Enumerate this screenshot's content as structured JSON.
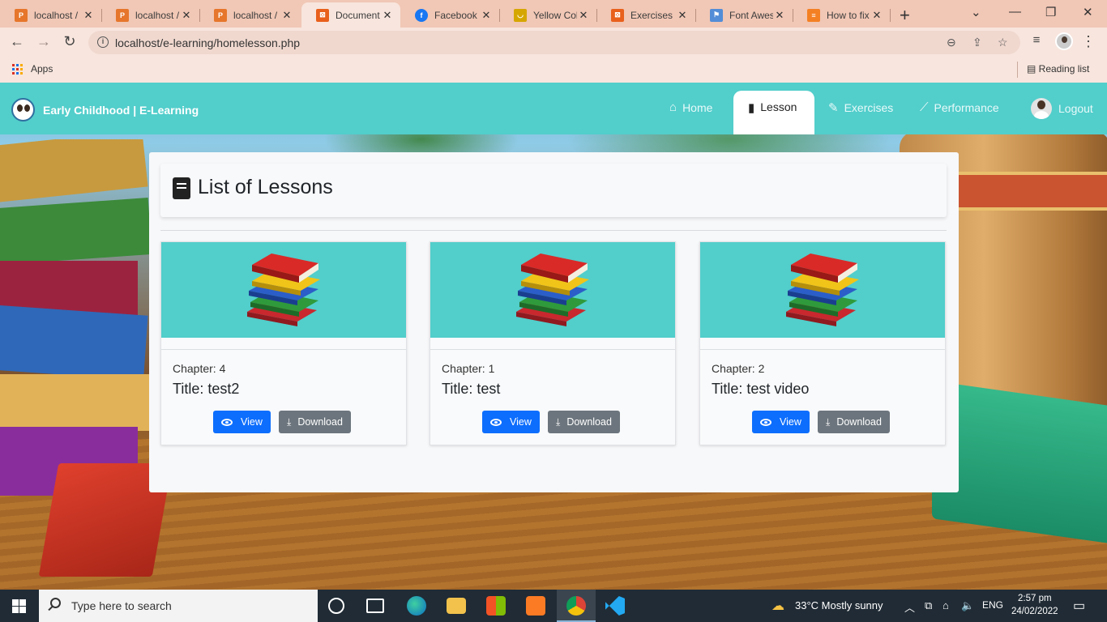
{
  "browser": {
    "tabs": [
      {
        "label": "localhost /",
        "favicon": "pma-icon",
        "color": "#e6762b"
      },
      {
        "label": "localhost /",
        "favicon": "pma-icon",
        "color": "#e6762b"
      },
      {
        "label": "localhost /",
        "favicon": "pma-icon",
        "color": "#e6762b"
      },
      {
        "label": "Document",
        "favicon": "xampp-icon",
        "color": "#e8601c"
      },
      {
        "label": "Facebook",
        "favicon": "facebook-icon",
        "color": "#1877f2"
      },
      {
        "label": "Yellow Col",
        "favicon": "cup-icon",
        "color": "#d6a600"
      },
      {
        "label": "Exercises",
        "favicon": "xampp-icon",
        "color": "#e8601c"
      },
      {
        "label": "Font Awes",
        "favicon": "flag-icon",
        "color": "#538dd7"
      },
      {
        "label": "How to fix",
        "favicon": "stack-icon",
        "color": "#f48024"
      }
    ],
    "active_tab": 3,
    "url": "localhost/e-learning/homelesson.php",
    "bookmarks": {
      "apps": "Apps",
      "reading_list": "Reading list"
    }
  },
  "navbar": {
    "brand": "Early Childhood | E-Learning",
    "items": [
      {
        "label": "Home",
        "icon": "home-icon"
      },
      {
        "label": "Lesson",
        "icon": "book-icon"
      },
      {
        "label": "Exercises",
        "icon": "pen-icon"
      },
      {
        "label": "Performance",
        "icon": "chart-line-icon"
      },
      {
        "label": "Logout",
        "icon": "avatar"
      }
    ],
    "active": "Lesson",
    "accent": "#52cecb"
  },
  "main": {
    "heading": "List of Lessons",
    "cards": [
      {
        "chapter": "Chapter: 4",
        "title": "Title: test2",
        "view": "View",
        "download": "Download"
      },
      {
        "chapter": "Chapter: 1",
        "title": "Title: test",
        "view": "View",
        "download": "Download"
      },
      {
        "chapter": "Chapter: 2",
        "title": "Title: test video",
        "view": "View",
        "download": "Download"
      }
    ],
    "colors": {
      "view_button": "#0d6efd",
      "download_button": "#6c757d"
    }
  },
  "taskbar": {
    "search_placeholder": "Type here to search",
    "weather": "33°C  Mostly sunny",
    "language": "ENG",
    "time": "2:57 pm",
    "date": "24/02/2022"
  }
}
